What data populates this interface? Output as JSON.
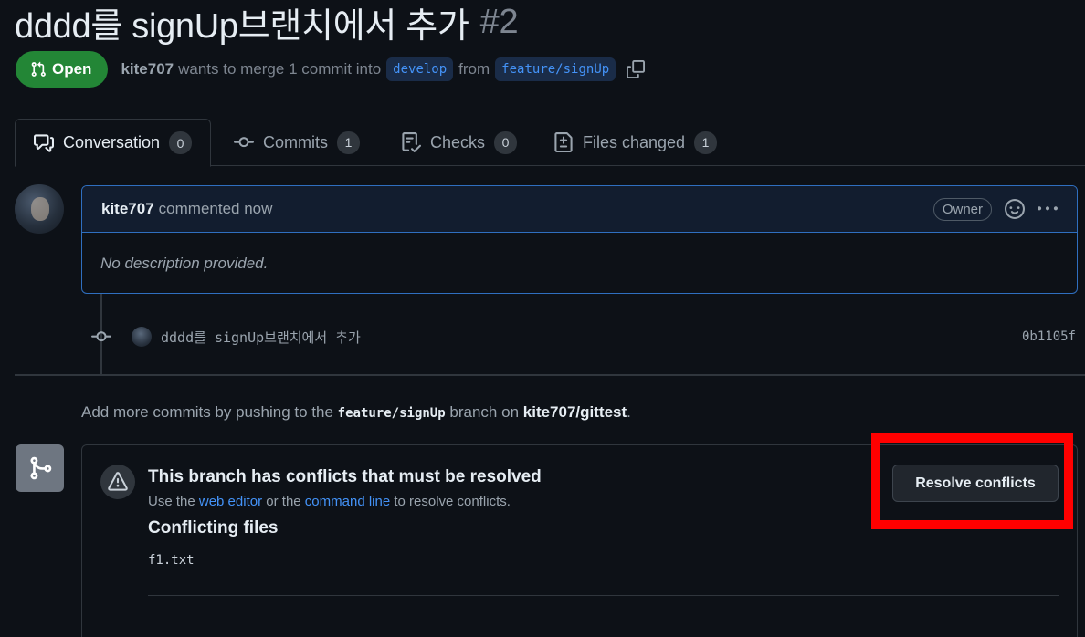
{
  "pr": {
    "title": "dddd를 signUp브랜치에서 추가",
    "number": "#2",
    "state": "Open",
    "author": "kite707",
    "merge_text": "wants to merge 1 commit into",
    "base_branch": "develop",
    "from_text": "from",
    "head_branch": "feature/signUp"
  },
  "tabs": [
    {
      "label": "Conversation",
      "count": "0",
      "icon": "comment-discussion-icon"
    },
    {
      "label": "Commits",
      "count": "1",
      "icon": "git-commit-icon"
    },
    {
      "label": "Checks",
      "count": "0",
      "icon": "checklist-icon"
    },
    {
      "label": "Files changed",
      "count": "1",
      "icon": "file-diff-icon"
    }
  ],
  "comment": {
    "author": "kite707",
    "meta": "commented now",
    "badge": "Owner",
    "body": "No description provided."
  },
  "commit": {
    "message": "dddd를 signUp브랜치에서 추가",
    "sha": "0b1105f"
  },
  "push_hint": {
    "prefix": "Add more commits by pushing to the",
    "branch": "feature/signUp",
    "middle": "branch on",
    "repo": "kite707/gittest",
    "suffix": "."
  },
  "merge_box": {
    "title": "This branch has conflicts that must be resolved",
    "desc_prefix": "Use the",
    "web_editor": "web editor",
    "desc_or": "or the",
    "command_line": "command line",
    "desc_suffix": "to resolve conflicts.",
    "files_title": "Conflicting files",
    "files": [
      "f1.txt"
    ],
    "resolve_button": "Resolve conflicts"
  },
  "colors": {
    "background": "#0d1117",
    "open_green": "#238636",
    "link_blue": "#4493f8",
    "highlight_red": "#ff0000"
  }
}
